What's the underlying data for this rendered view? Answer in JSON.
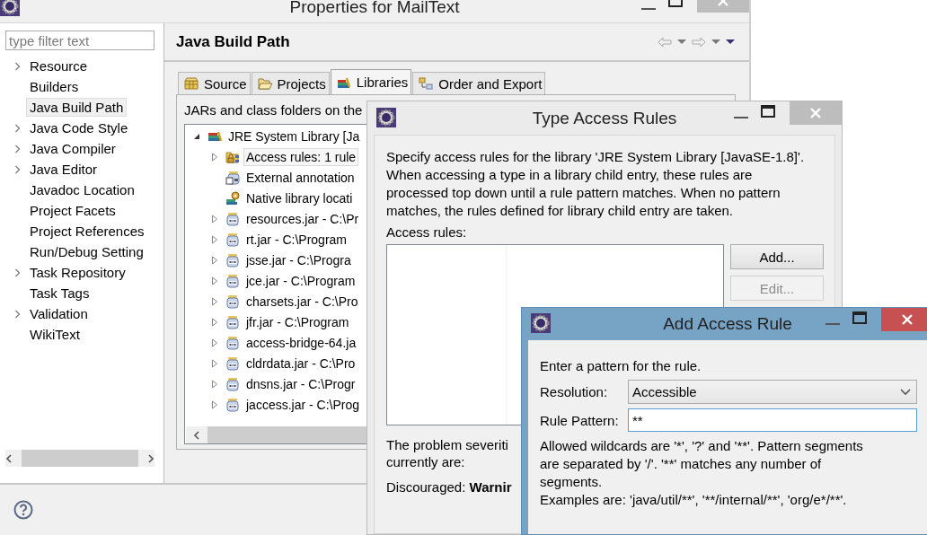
{
  "properties_window": {
    "title": "Properties for MailText",
    "active": false,
    "filter": {
      "placeholder": "type filter text"
    },
    "sidebar": {
      "items": [
        {
          "label": "Resource",
          "expandable": true,
          "selected": false
        },
        {
          "label": "Builders",
          "expandable": false,
          "selected": false
        },
        {
          "label": "Java Build Path",
          "expandable": false,
          "selected": true
        },
        {
          "label": "Java Code Style",
          "expandable": true,
          "selected": false
        },
        {
          "label": "Java Compiler",
          "expandable": true,
          "selected": false
        },
        {
          "label": "Java Editor",
          "expandable": true,
          "selected": false
        },
        {
          "label": "Javadoc Location",
          "expandable": false,
          "selected": false
        },
        {
          "label": "Project Facets",
          "expandable": false,
          "selected": false
        },
        {
          "label": "Project References",
          "expandable": false,
          "selected": false
        },
        {
          "label": "Run/Debug Setting",
          "expandable": false,
          "selected": false
        },
        {
          "label": "Task Repository",
          "expandable": true,
          "selected": false
        },
        {
          "label": "Task Tags",
          "expandable": false,
          "selected": false
        },
        {
          "label": "Validation",
          "expandable": true,
          "selected": false
        },
        {
          "label": "WikiText",
          "expandable": false,
          "selected": false
        }
      ]
    },
    "page_title": "Java Build Path",
    "tabs": [
      {
        "label": "Source",
        "selected": false
      },
      {
        "label": "Projects",
        "selected": false
      },
      {
        "label": "Libraries",
        "selected": true
      },
      {
        "label": "Order and Export",
        "selected": false
      }
    ],
    "description": "JARs and class folders on the",
    "tree": [
      {
        "label": "JRE System Library [Ja",
        "kind": "library",
        "expandable": true,
        "expanded": true,
        "selected": false,
        "children": [
          {
            "label": "Access rules: 1 rule",
            "kind": "rules",
            "expandable": true,
            "expanded": false,
            "selected": true
          },
          {
            "label": "External annotation",
            "kind": "annotation",
            "expandable": false,
            "expanded": false,
            "selected": false
          },
          {
            "label": "Native library locati",
            "kind": "native",
            "expandable": false,
            "expanded": false,
            "selected": false
          },
          {
            "label": "resources.jar - C:\\Pr",
            "kind": "jar",
            "expandable": true,
            "expanded": false,
            "selected": false
          },
          {
            "label": "rt.jar - C:\\Program",
            "kind": "jar",
            "expandable": true,
            "expanded": false,
            "selected": false
          },
          {
            "label": "jsse.jar - C:\\Progra",
            "kind": "jar",
            "expandable": true,
            "expanded": false,
            "selected": false
          },
          {
            "label": "jce.jar - C:\\Program",
            "kind": "jar",
            "expandable": true,
            "expanded": false,
            "selected": false
          },
          {
            "label": "charsets.jar - C:\\Pro",
            "kind": "jar",
            "expandable": true,
            "expanded": false,
            "selected": false
          },
          {
            "label": "jfr.jar - C:\\Program",
            "kind": "jar",
            "expandable": true,
            "expanded": false,
            "selected": false
          },
          {
            "label": "access-bridge-64.ja",
            "kind": "jar",
            "expandable": true,
            "expanded": false,
            "selected": false
          },
          {
            "label": "cldrdata.jar - C:\\Pro",
            "kind": "jar",
            "expandable": true,
            "expanded": false,
            "selected": false
          },
          {
            "label": "dnsns.jar - C:\\Progr",
            "kind": "jar",
            "expandable": true,
            "expanded": false,
            "selected": false
          },
          {
            "label": "jaccess.jar - C:\\Prog",
            "kind": "jar",
            "expandable": true,
            "expanded": false,
            "selected": false
          }
        ]
      }
    ]
  },
  "type_access_rules": {
    "title": "Type Access Rules",
    "active": false,
    "description": "Specify access rules for the library 'JRE System Library [JavaSE-1.8]'.\nWhen accessing a type in a library child entry, these rules are processed top down until a rule pattern matches. When no pattern matches, the rules defined for library child entry are taken.",
    "list_label": "Access rules:",
    "buttons": [
      {
        "label": "Add...",
        "disabled": false
      },
      {
        "label": "Edit...",
        "disabled": true
      }
    ],
    "severity_lines": [
      "The problem severiti",
      "currently are:"
    ],
    "discouraged": "Discouraged: **Warnir**"
  },
  "add_access_rule": {
    "title": "Add Access Rule",
    "active": true,
    "prompt": "Enter a pattern for the rule.",
    "resolution": {
      "label": "Resolution:",
      "value": "Accessible"
    },
    "pattern": {
      "label": "Rule Pattern:",
      "value": "**"
    },
    "help": "Allowed wildcards are '*', '?' and '**'. Pattern segments are separated by '/'. '**' matches any number of segments.",
    "examples": "Examples are: 'java/util/**', '**/internal/**', 'org/e*/**'."
  }
}
